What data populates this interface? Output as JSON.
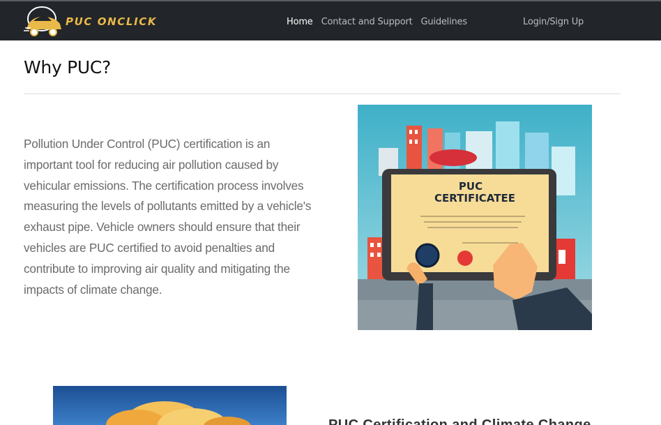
{
  "brand": {
    "name": "PUC ONCLICK",
    "logo_icon": "car-logo-icon"
  },
  "nav": {
    "items": [
      {
        "label": "Home",
        "active": true
      },
      {
        "label": "Contact and Support",
        "active": false
      },
      {
        "label": "Guidelines",
        "active": false
      }
    ],
    "login_label": "Login/Sign Up"
  },
  "section": {
    "title": "Why PUC?",
    "paragraph": "Pollution Under Control (PUC) certification is an important tool for reducing air pollution caused by vehicular emissions. The certification process involves measuring the levels of pollutants emitted by a vehicle's exhaust pipe. Vehicle owners should ensure that their vehicles are PUC certified to avoid penalties and contribute to improving air quality and mitigating the impacts of climate change.",
    "image": {
      "certificate_line1": "PUC",
      "certificate_line2": "CERTIFICATEE"
    }
  },
  "next_section": {
    "heading_partial": "PUC Certification and Climate Change"
  },
  "colors": {
    "navbar_bg": "#222529",
    "brand_accent": "#e9b949",
    "text_muted": "#6b6b6b"
  }
}
